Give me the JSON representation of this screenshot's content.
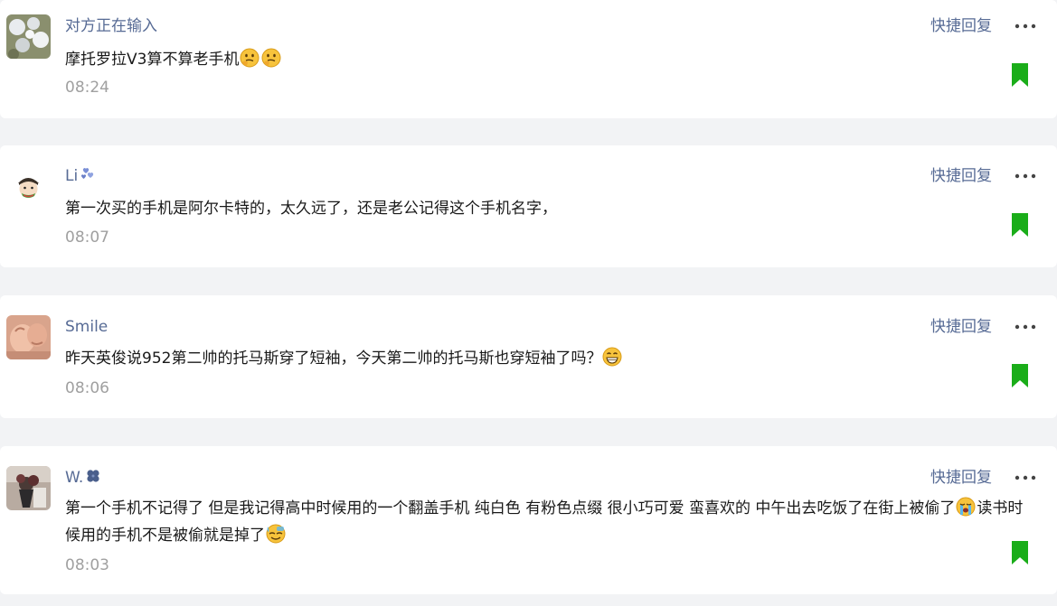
{
  "colors": {
    "nickname": "#576b95",
    "text": "#191919",
    "time": "#a0a0a0",
    "bookmark": "#1aad19",
    "background": "#f2f3f5"
  },
  "actions": {
    "quick_reply": "快捷回复",
    "more_icon": "more-dots-icon",
    "bookmark_icon": "bookmark-icon"
  },
  "comments": [
    {
      "nickname": "对方正在输入",
      "text_parts": [
        "摩托罗拉V3算不算老手机"
      ],
      "emojis": [
        "thinking-face-emoji",
        "thinking-face-emoji"
      ],
      "time": "08:24"
    },
    {
      "nickname": "Li",
      "nickname_icon": "blue-hearts-icon",
      "text_parts": [
        "第一次买的手机是阿尔卡特的，太久远了，还是老公记得这个手机名字，"
      ],
      "time": "08:07"
    },
    {
      "nickname": "Smile",
      "text_parts": [
        "昨天英俊说952第二帅的托马斯穿了短袖，今天第二帅的托马斯也穿短袖了吗？"
      ],
      "emojis": [
        "grinning-face-emoji"
      ],
      "time": "08:06"
    },
    {
      "nickname": "W.",
      "nickname_icon": "clover-icon",
      "text_parts": [
        "第一个手机不记得了 但是我记得高中时候用的一个翻盖手机 纯白色 有粉色点缀 很小巧可爱 蛮喜欢的 中午出去吃饭了在街上被偷了",
        "读书时候用的手机不是被偷就是掉了"
      ],
      "emojis": [
        "crying-face-emoji",
        "sweat-face-emoji"
      ],
      "time": "08:03"
    }
  ]
}
